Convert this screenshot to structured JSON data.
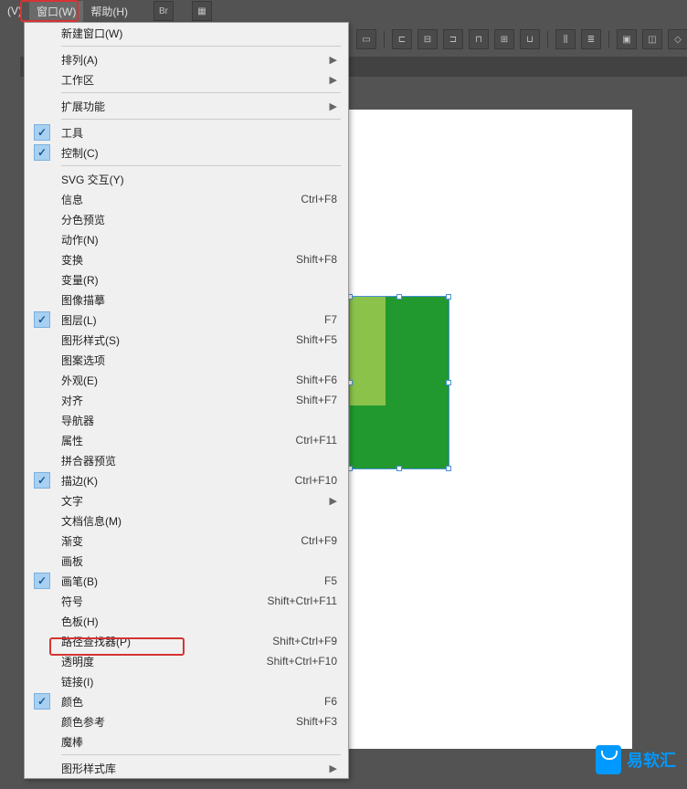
{
  "menubar": {
    "items": [
      "(V)",
      "窗口(W)",
      "帮助(H)"
    ]
  },
  "toolbar": {
    "br_label": "Br"
  },
  "menu": {
    "items": [
      {
        "label": "新建窗口(W)",
        "shortcut": "",
        "arrow": false,
        "checked": false,
        "sep_after": true
      },
      {
        "label": "排列(A)",
        "shortcut": "",
        "arrow": true,
        "checked": false,
        "sep_after": false
      },
      {
        "label": "工作区",
        "shortcut": "",
        "arrow": true,
        "checked": false,
        "sep_after": true
      },
      {
        "label": "扩展功能",
        "shortcut": "",
        "arrow": true,
        "checked": false,
        "sep_after": true
      },
      {
        "label": "工具",
        "shortcut": "",
        "arrow": false,
        "checked": true,
        "sep_after": false
      },
      {
        "label": "控制(C)",
        "shortcut": "",
        "arrow": false,
        "checked": true,
        "sep_after": true
      },
      {
        "label": "SVG 交互(Y)",
        "shortcut": "",
        "arrow": false,
        "checked": false,
        "sep_after": false
      },
      {
        "label": "信息",
        "shortcut": "Ctrl+F8",
        "arrow": false,
        "checked": false,
        "sep_after": false
      },
      {
        "label": "分色预览",
        "shortcut": "",
        "arrow": false,
        "checked": false,
        "sep_after": false
      },
      {
        "label": "动作(N)",
        "shortcut": "",
        "arrow": false,
        "checked": false,
        "sep_after": false
      },
      {
        "label": "变换",
        "shortcut": "Shift+F8",
        "arrow": false,
        "checked": false,
        "sep_after": false
      },
      {
        "label": "变量(R)",
        "shortcut": "",
        "arrow": false,
        "checked": false,
        "sep_after": false
      },
      {
        "label": "图像描摹",
        "shortcut": "",
        "arrow": false,
        "checked": false,
        "sep_after": false
      },
      {
        "label": "图层(L)",
        "shortcut": "F7",
        "arrow": false,
        "checked": true,
        "sep_after": false
      },
      {
        "label": "图形样式(S)",
        "shortcut": "Shift+F5",
        "arrow": false,
        "checked": false,
        "sep_after": false
      },
      {
        "label": "图案选项",
        "shortcut": "",
        "arrow": false,
        "checked": false,
        "sep_after": false
      },
      {
        "label": "外观(E)",
        "shortcut": "Shift+F6",
        "arrow": false,
        "checked": false,
        "sep_after": false
      },
      {
        "label": "对齐",
        "shortcut": "Shift+F7",
        "arrow": false,
        "checked": false,
        "sep_after": false
      },
      {
        "label": "导航器",
        "shortcut": "",
        "arrow": false,
        "checked": false,
        "sep_after": false
      },
      {
        "label": "属性",
        "shortcut": "Ctrl+F11",
        "arrow": false,
        "checked": false,
        "sep_after": false
      },
      {
        "label": "拼合器预览",
        "shortcut": "",
        "arrow": false,
        "checked": false,
        "sep_after": false
      },
      {
        "label": "描边(K)",
        "shortcut": "Ctrl+F10",
        "arrow": false,
        "checked": true,
        "sep_after": false
      },
      {
        "label": "文字",
        "shortcut": "",
        "arrow": true,
        "checked": false,
        "sep_after": false
      },
      {
        "label": "文档信息(M)",
        "shortcut": "",
        "arrow": false,
        "checked": false,
        "sep_after": false
      },
      {
        "label": "渐变",
        "shortcut": "Ctrl+F9",
        "arrow": false,
        "checked": false,
        "sep_after": false
      },
      {
        "label": "画板",
        "shortcut": "",
        "arrow": false,
        "checked": false,
        "sep_after": false
      },
      {
        "label": "画笔(B)",
        "shortcut": "F5",
        "arrow": false,
        "checked": true,
        "sep_after": false
      },
      {
        "label": "符号",
        "shortcut": "Shift+Ctrl+F11",
        "arrow": false,
        "checked": false,
        "sep_after": false
      },
      {
        "label": "色板(H)",
        "shortcut": "",
        "arrow": false,
        "checked": false,
        "sep_after": false
      },
      {
        "label": "路径查找器(P)",
        "shortcut": "Shift+Ctrl+F9",
        "arrow": false,
        "checked": false,
        "sep_after": false
      },
      {
        "label": "透明度",
        "shortcut": "Shift+Ctrl+F10",
        "arrow": false,
        "checked": false,
        "sep_after": false
      },
      {
        "label": "链接(I)",
        "shortcut": "",
        "arrow": false,
        "checked": false,
        "sep_after": false
      },
      {
        "label": "颜色",
        "shortcut": "F6",
        "arrow": false,
        "checked": true,
        "sep_after": false
      },
      {
        "label": "颜色参考",
        "shortcut": "Shift+F3",
        "arrow": false,
        "checked": false,
        "sep_after": false
      },
      {
        "label": "魔棒",
        "shortcut": "",
        "arrow": false,
        "checked": false,
        "sep_after": true
      },
      {
        "label": "图形样式库",
        "shortcut": "",
        "arrow": true,
        "checked": false,
        "sep_after": false
      }
    ]
  },
  "watermark": {
    "text": "易软汇"
  }
}
